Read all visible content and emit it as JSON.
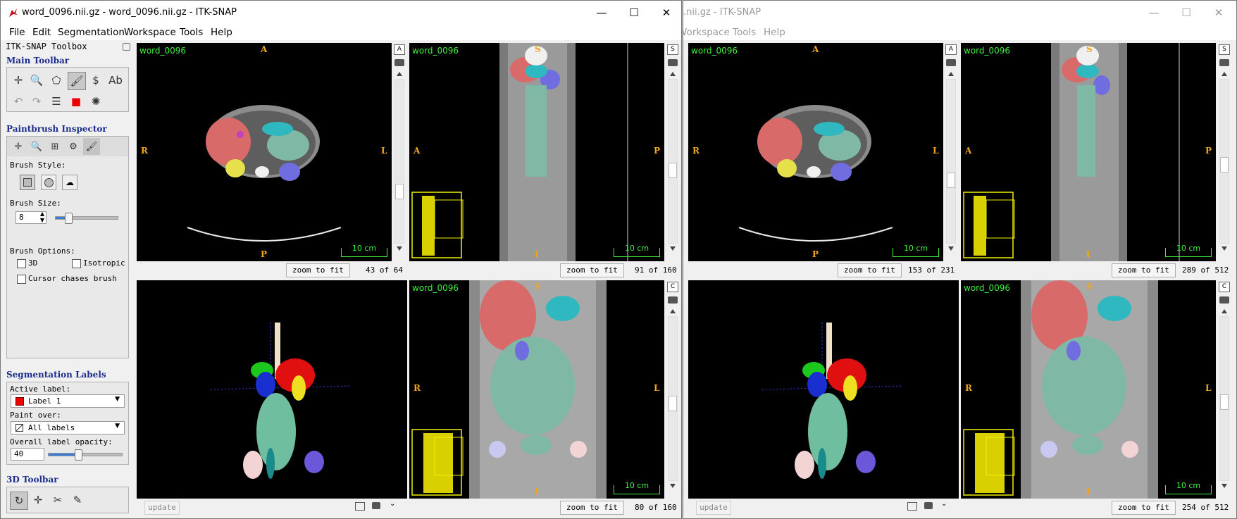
{
  "left_window": {
    "title": "word_0096.nii.gz - word_0096.nii.gz - ITK-SNAP",
    "menu": [
      "File",
      "Edit",
      "Segmentation",
      "Workspace",
      "Tools",
      "Help"
    ],
    "window_buttons": {
      "minimize": "—",
      "maximize": "☐",
      "close": "✕"
    }
  },
  "right_window": {
    "title": ".nii.gz - ITK-SNAP",
    "menu": [
      "Workspace",
      "Tools",
      "Help"
    ],
    "window_buttons": {
      "minimize": "—",
      "maximize": "☐",
      "close": "✕"
    }
  },
  "toolbox": {
    "title": "ITK-SNAP Toolbox",
    "main_toolbar": "Main Toolbar",
    "paintbrush_inspector": "Paintbrush Inspector",
    "brush_style_label": "Brush Style:",
    "brush_size_label": "Brush Size:",
    "brush_size_value": "8",
    "brush_size_level": 0.2,
    "brush_options_label": "Brush Options:",
    "opt_3d": "3D",
    "opt_isotropic": "Isotropic",
    "opt_cursor": "Cursor chases brush",
    "segmentation_labels": "Segmentation Labels",
    "active_label_caption": "Active label:",
    "active_label": "Label 1",
    "paint_over_caption": "Paint over:",
    "paint_over": "All labels",
    "opacity_caption": "Overall label opacity:",
    "opacity_value": "40",
    "opacity_level": 0.4,
    "toolbar_3d": "3D Toolbar"
  },
  "views": {
    "name": "word_0096",
    "scale": "10 cm",
    "zoom_to_fit": "zoom to fit",
    "update": "update",
    "left": {
      "axial_slice": "43 of 64",
      "sagittal_slice": "91 of 160",
      "coronal_slice": "80 of 160"
    },
    "right": {
      "axial_slice": "153 of 231",
      "sagittal_slice": "289 of 512",
      "coronal_slice": "254 of 512"
    },
    "orient": {
      "A": "A",
      "P": "P",
      "R": "R",
      "L": "L",
      "S": "S",
      "I": "I"
    },
    "sidebar_letters": {
      "axial": "A",
      "sagittal": "S",
      "coronal": "C"
    }
  },
  "colors": {
    "label_green": "#3ef03e",
    "orient_yellow": "#f2a51e",
    "liver": "#e66060",
    "spleen": "#55b8e0"
  }
}
